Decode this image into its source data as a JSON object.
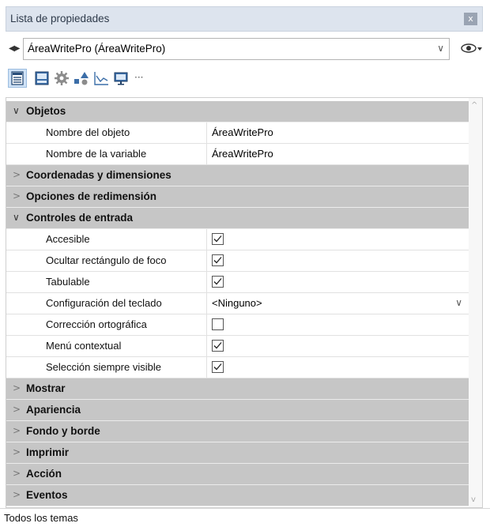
{
  "window": {
    "title": "Lista de propiedades",
    "close_symbol": "x"
  },
  "selector": {
    "value": "ÁreaWritePro (ÁreaWritePro)",
    "nav_symbol": "◀▶",
    "dropdown_symbol": "∨"
  },
  "toolbar": {
    "buttons": [
      {
        "icon": "property-list-icon",
        "active": true
      },
      {
        "icon": "form-icon"
      },
      {
        "icon": "gear-icon"
      },
      {
        "icon": "shapes-icon"
      },
      {
        "icon": "chart-icon"
      },
      {
        "icon": "monitor-icon"
      },
      {
        "icon": "more-icon",
        "symbol": "···"
      }
    ]
  },
  "sections": {
    "objetos": {
      "label": "Objetos",
      "expanded": true,
      "rows": [
        {
          "label": "Nombre del objeto",
          "value": "ÁreaWritePro"
        },
        {
          "label": "Nombre de la variable",
          "value": "ÁreaWritePro"
        }
      ]
    },
    "coordenadas": {
      "label": "Coordenadas y dimensiones",
      "expanded": false
    },
    "redimension": {
      "label": "Opciones de redimensión",
      "expanded": false
    },
    "controles": {
      "label": "Controles de entrada",
      "expanded": true,
      "rows": [
        {
          "label": "Accesible",
          "checked": true
        },
        {
          "label": "Ocultar rectángulo de foco",
          "checked": true
        },
        {
          "label": "Tabulable",
          "checked": true
        },
        {
          "label": "Configuración del teclado",
          "value": "<Ninguno>"
        },
        {
          "label": "Corrección ortográfica",
          "checked": false
        },
        {
          "label": "Menú contextual",
          "checked": true
        },
        {
          "label": "Selección siempre visible",
          "checked": true
        }
      ]
    },
    "mostrar": {
      "label": "Mostrar",
      "expanded": false
    },
    "apariencia": {
      "label": "Apariencia",
      "expanded": false
    },
    "fondo": {
      "label": "Fondo y borde",
      "expanded": false
    },
    "imprimir": {
      "label": "Imprimir",
      "expanded": false
    },
    "accion": {
      "label": "Acción",
      "expanded": false
    },
    "eventos": {
      "label": "Eventos",
      "expanded": false
    }
  },
  "chevrons": {
    "expanded": "∨",
    "collapsed": ">"
  },
  "status": {
    "text": "Todos los temas"
  },
  "colors": {
    "header_bg": "#c6c6c6",
    "titlebar_bg": "#dde4ee",
    "active_tab": "#cfe2f6"
  }
}
